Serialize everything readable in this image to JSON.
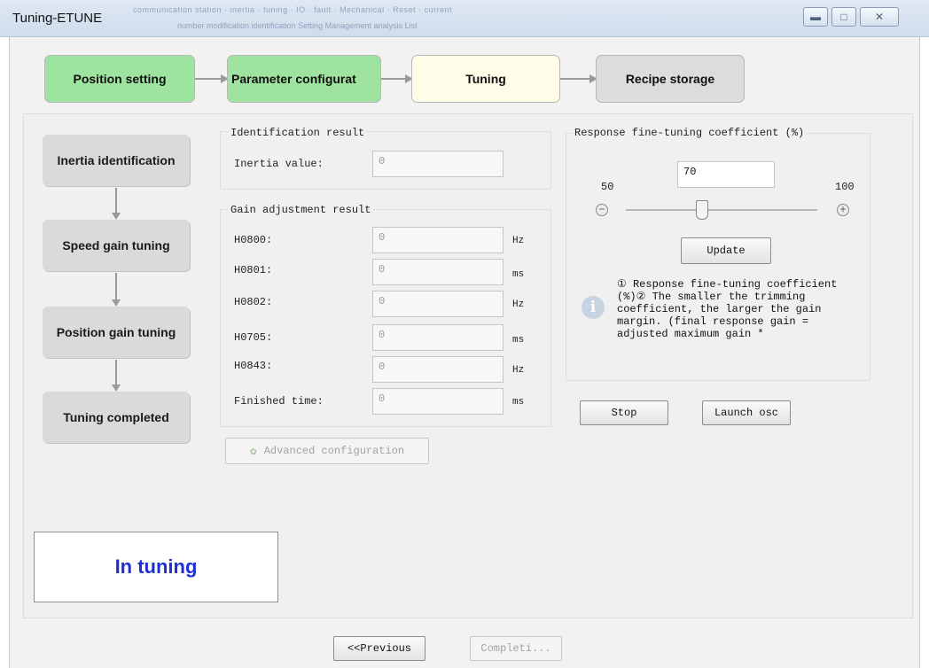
{
  "window": {
    "title": "Tuning-ETUNE",
    "bg_text_1": "communication station  ·  inertia  ·  tuning  ·  IO  ·  fault  ·  Mechanical  ·  Reset  ·  current",
    "bg_text_2": "number modification    identification    Setting Management    analysis    List"
  },
  "steps": [
    {
      "label": "Position setting",
      "color": "#9fe3a0",
      "state": "done"
    },
    {
      "label": "Parameter configurat",
      "color": "#9fe3a0",
      "state": "done"
    },
    {
      "label": "Tuning",
      "color": "#fffde8",
      "state": "active"
    },
    {
      "label": "Recipe storage",
      "color": "#dcdcdc",
      "state": "pending"
    }
  ],
  "flow": [
    {
      "label": "Inertia identification"
    },
    {
      "label": "Speed gain tuning"
    },
    {
      "label": "Position gain tuning"
    },
    {
      "label": "Tuning completed"
    }
  ],
  "status_text": "In tuning",
  "identification": {
    "title": "Identification result",
    "label": "Inertia value:",
    "value": "0"
  },
  "gain": {
    "title": "Gain adjustment result",
    "rows": [
      {
        "label": "H0800:",
        "value": "0",
        "unit": "Hz"
      },
      {
        "label": "H0801:",
        "value": "0",
        "unit": "ms"
      },
      {
        "label": "H0802:",
        "value": "0",
        "unit": "Hz"
      },
      {
        "label": "H0705:",
        "value": "0",
        "unit": "ms"
      },
      {
        "label": "H0843:",
        "value": "0",
        "unit": "Hz"
      },
      {
        "label": "Finished time:",
        "value": "0",
        "unit": "ms"
      }
    ]
  },
  "advanced_label": "Advanced configuration",
  "response": {
    "title": "Response fine-tuning coefficient (%)",
    "value": "70",
    "min_label": "50",
    "max_label": "100",
    "slider_level": 0.4,
    "update_label": "Update",
    "info_text": "① Response fine-tuning coefficient (%)② The smaller the trimming coefficient, the larger the gain margin. (final response gain = adjusted maximum gain *"
  },
  "actions": {
    "stop_label": "Stop",
    "launch_label": "Launch osc"
  },
  "nav": {
    "previous_label": "<<Previous",
    "complete_label": "Completi..."
  },
  "icons": {
    "minimize": "minimize-icon",
    "maximize": "maximize-icon",
    "close": "close-icon",
    "info": "info-icon",
    "minus": "minus-icon",
    "plus": "plus-icon",
    "advanced": "settings-leaf-icon"
  }
}
